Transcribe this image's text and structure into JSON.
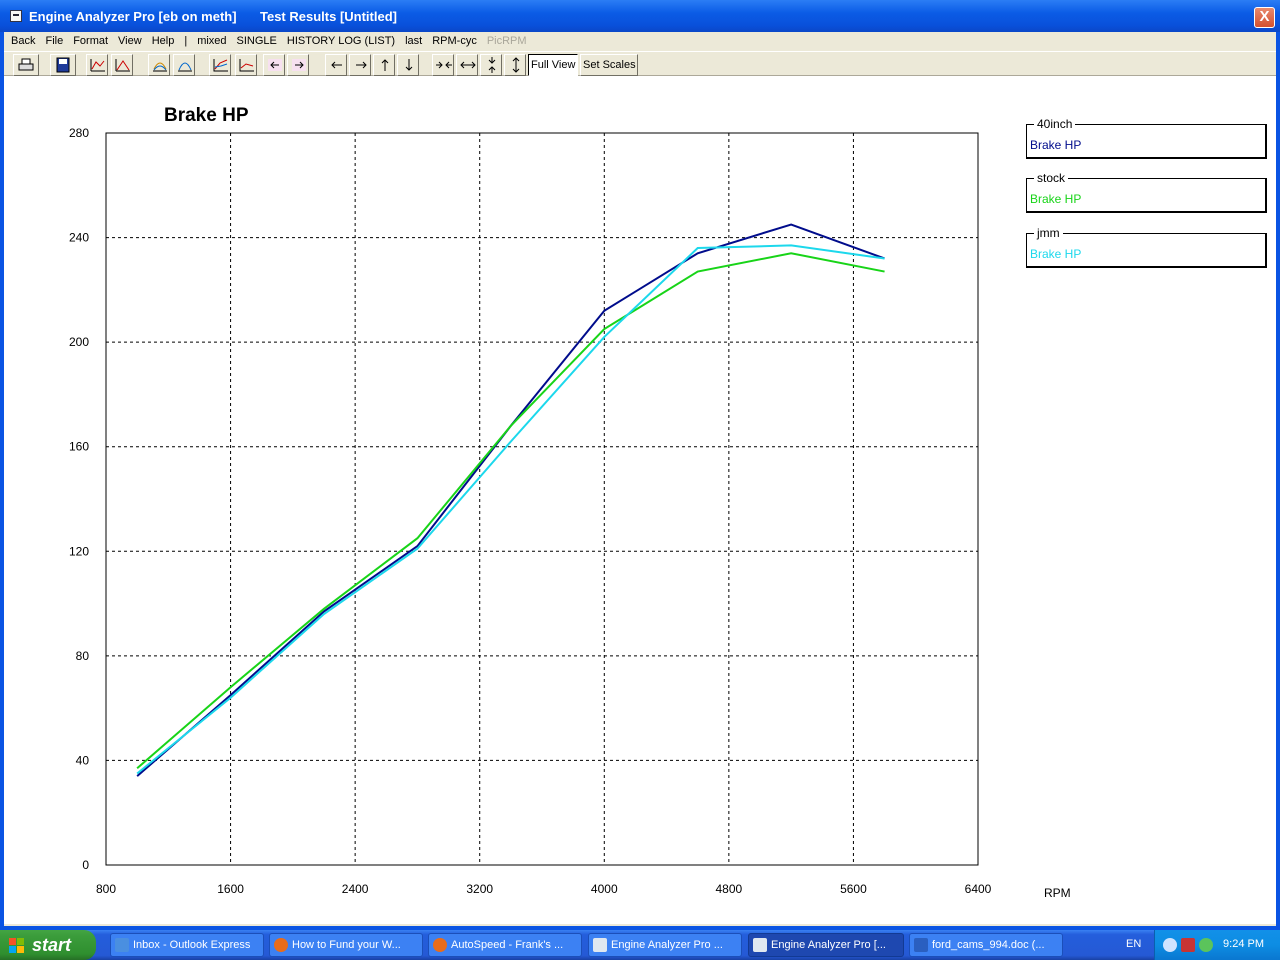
{
  "window": {
    "title": "Engine Analyzer Pro [eb on meth]",
    "subtitle": "Test Results [Untitled]",
    "close_label": "X"
  },
  "menu": {
    "items": [
      "Back",
      "File",
      "Format",
      "View",
      "Help",
      "|",
      "mixed",
      "SINGLE",
      "HISTORY LOG (LIST)",
      "last",
      "RPM-cyc"
    ],
    "disabled_item": "PicRPM"
  },
  "toolbar": {
    "full_view_label": "Full View",
    "set_scales_label": "Set Scales"
  },
  "legend": [
    {
      "title": "40inch",
      "series": "Brake HP",
      "color": "#000c8c"
    },
    {
      "title": "stock",
      "series": "Brake HP",
      "color": "#18d418"
    },
    {
      "title": "jmm",
      "series": "Brake HP",
      "color": "#1cd8ec"
    }
  ],
  "chart_data": {
    "type": "line",
    "title": "Brake HP",
    "xlabel": "RPM",
    "ylabel": "",
    "xlim": [
      800,
      6400
    ],
    "ylim": [
      0,
      280
    ],
    "xticks": [
      800,
      1600,
      2400,
      3200,
      4000,
      4800,
      5600,
      6400
    ],
    "yticks": [
      0,
      40,
      80,
      120,
      160,
      200,
      240,
      280
    ],
    "grid": true,
    "legend_position": "right",
    "x": [
      1000,
      1600,
      2200,
      2800,
      3400,
      4000,
      4600,
      5200,
      5800
    ],
    "series": [
      {
        "name": "40inch",
        "color": "#000c8c",
        "values": [
          34,
          65,
          97,
          122,
          168,
          212,
          234,
          245,
          232
        ]
      },
      {
        "name": "stock",
        "color": "#18d418",
        "values": [
          37,
          68,
          98,
          125,
          168,
          205,
          227,
          234,
          227
        ]
      },
      {
        "name": "jmm",
        "color": "#1cd8ec",
        "values": [
          35,
          64,
          96,
          121,
          162,
          202,
          236,
          237,
          232
        ]
      }
    ]
  },
  "taskbar": {
    "start_label": "start",
    "tasks": [
      {
        "label": "Inbox - Outlook Express",
        "color": "#4a8fe0"
      },
      {
        "label": "How to Fund your W...",
        "color": "#e86c1a"
      },
      {
        "label": "AutoSpeed - Frank's ...",
        "color": "#e86c1a"
      },
      {
        "label": "Engine Analyzer Pro  ...",
        "color": "#e0e8f0"
      },
      {
        "label": "Engine Analyzer Pro [...",
        "color": "#e0e8f0"
      },
      {
        "label": "ford_cams_994.doc (...",
        "color": "#2a5fc0"
      }
    ],
    "lang": "EN",
    "clock": "9:24 PM"
  }
}
